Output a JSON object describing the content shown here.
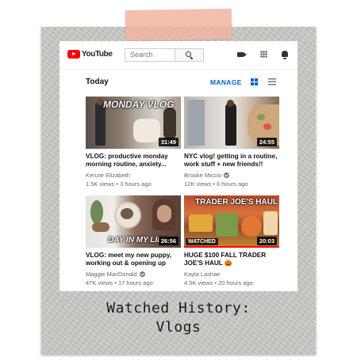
{
  "header": {
    "logo_text": "YouTube",
    "search_placeholder": "Search"
  },
  "section": {
    "title": "Today",
    "manage_label": "MANAGE"
  },
  "videos": [
    {
      "title_line1": "VLOG: productive monday",
      "title_line2": "morning routine, anxiety...",
      "channel": "Kenzie Elizabeth",
      "verified": false,
      "meta": "1.5K views • 3 hours ago",
      "duration": "31:49",
      "overlay": "MONDAY VLOG",
      "watched": false
    },
    {
      "title_line1": "NYC vlog! getting in a routine,",
      "title_line2": "work stuff + new friends!!",
      "channel": "Brooke Miccio",
      "verified": true,
      "meta": "12K views • 6 hours ago",
      "duration": "24:55",
      "overlay": "",
      "watched": false
    },
    {
      "title_line1": "VLOG: meet my new puppy,",
      "title_line2": "working out & opening up",
      "channel": "Maggie MacDonald",
      "verified": true,
      "meta": "47K views • 17 hours ago",
      "duration": "26:56",
      "overlay": "DAY IN MY LIFE",
      "watched": false
    },
    {
      "title_line1": "HUGE $100 FALL TRADER",
      "title_line2": "JOE'S HAUL 🎃",
      "channel": "Kayla Lashae",
      "verified": false,
      "meta": "4.5K views • 20 hours ago",
      "duration": "20:03",
      "overlay": "TRADER JOE'S HAUL",
      "watched": true,
      "watched_label": "WATCHED",
      "progress": 1.0
    }
  ],
  "caption": {
    "line1": "Watched History:",
    "line2": "Vlogs"
  },
  "colors": {
    "brand_red": "#ff0000",
    "link_blue": "#065fd4",
    "paper_gray": "#c9c9c6",
    "tape_pink": "#f2b4a0"
  }
}
